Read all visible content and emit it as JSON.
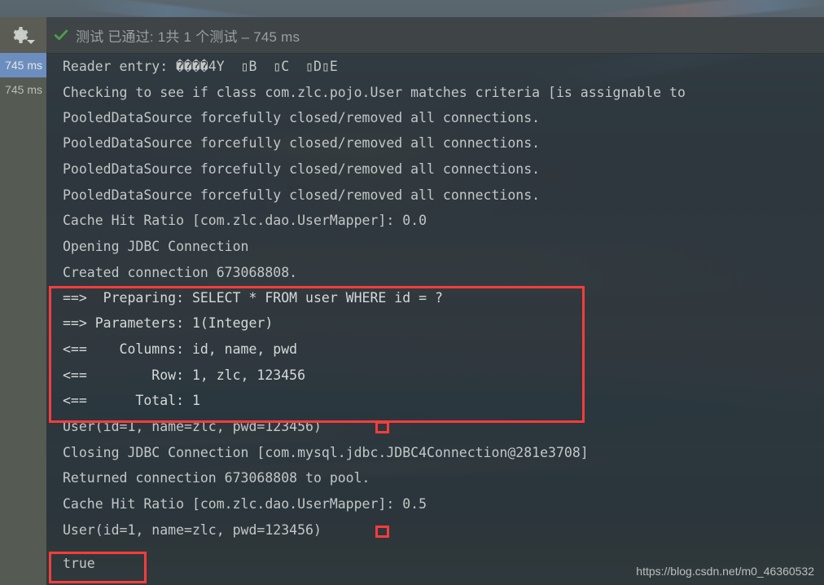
{
  "window": {
    "toolbar": {
      "gear_icon": "gear-icon",
      "dropdown_icon": "chevron-down-icon"
    },
    "status": {
      "check_icon": "check-mark-icon",
      "text": "测试 已通过: 1共 1 个测试 – 745 ms",
      "label": "测试 已通过:",
      "count": "1共 1 个测试",
      "duration": "745 ms",
      "accent_color": "#4e9a4e"
    }
  },
  "test_tree": {
    "rows": [
      {
        "duration": "745 ms",
        "selected": true
      },
      {
        "duration": "745 ms",
        "selected": false
      }
    ],
    "selected_color": "#6c8ebf"
  },
  "console": {
    "lines": [
      "Reader entry: ����4Y  ▯B  ▯C  ▯D▯E",
      "Checking to see if class com.zlc.pojo.User matches criteria [is assignable to",
      "PooledDataSource forcefully closed/removed all connections.",
      "PooledDataSource forcefully closed/removed all connections.",
      "PooledDataSource forcefully closed/removed all connections.",
      "PooledDataSource forcefully closed/removed all connections.",
      "Cache Hit Ratio [com.zlc.dao.UserMapper]: 0.0",
      "Opening JDBC Connection",
      "Created connection 673068808.",
      "==>  Preparing: SELECT * FROM user WHERE id = ?",
      "==> Parameters: 1(Integer)",
      "<==    Columns: id, name, pwd",
      "<==        Row: 1, zlc, 123456",
      "<==      Total: 1",
      "User(id=1, name=zlc, pwd=123456)",
      "Closing JDBC Connection [com.mysql.jdbc.JDBC4Connection@281e3708]",
      "Returned connection 673068808 to pool.",
      "Cache Hit Ratio [com.zlc.dao.UserMapper]: 0.5",
      "User(id=1, name=zlc, pwd=123456)",
      "true"
    ]
  },
  "annotations": {
    "color": "#fa3c3c",
    "sql_box_label": "sql-log-highlight-box",
    "result_box_label": "true-result-highlight-box",
    "marker_label": "user-output-marker"
  },
  "watermark": {
    "text": "https://blog.csdn.net/m0_46360532"
  }
}
